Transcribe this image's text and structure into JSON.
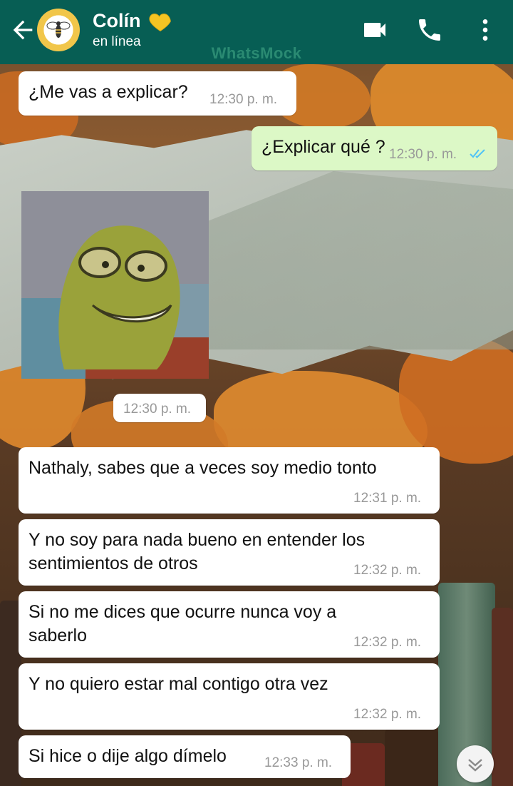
{
  "header": {
    "contact_name": "Colín",
    "status": "en línea",
    "watermark": "WhatsMock",
    "bg_color": "#075e54",
    "icons": [
      "back-arrow-icon",
      "bee-avatar",
      "yellow-heart-icon",
      "video-call-icon",
      "phone-icon",
      "more-vert-icon"
    ]
  },
  "messages": [
    {
      "dir": "in",
      "text": "¿Me vas a explicar?",
      "time": "12:30 p. m."
    },
    {
      "dir": "out",
      "text": "¿Explicar qué ?",
      "time": "12:30 p. m.",
      "ticks": "read"
    },
    {
      "dir": "in",
      "type": "image",
      "time": "12:30 p. m."
    },
    {
      "dir": "in",
      "text": "Nathaly, sabes que a veces soy medio tonto",
      "time": "12:31 p. m."
    },
    {
      "dir": "in",
      "text": "Y no soy para nada bueno en entender los sentimientos de otros",
      "time": "12:32 p. m."
    },
    {
      "dir": "in",
      "text": "Si no me dices que ocurre nunca voy a saberlo",
      "time": "12:32 p. m."
    },
    {
      "dir": "in",
      "text": "Y no quiero estar mal contigo otra vez",
      "time": "12:32 p. m."
    },
    {
      "dir": "in",
      "text": "Si hice o dije algo dímelo",
      "time": "12:33 p. m."
    }
  ],
  "colors": {
    "incoming": "#ffffff",
    "outgoing": "#dcf8c6",
    "read_ticks": "#4fc3f7"
  }
}
